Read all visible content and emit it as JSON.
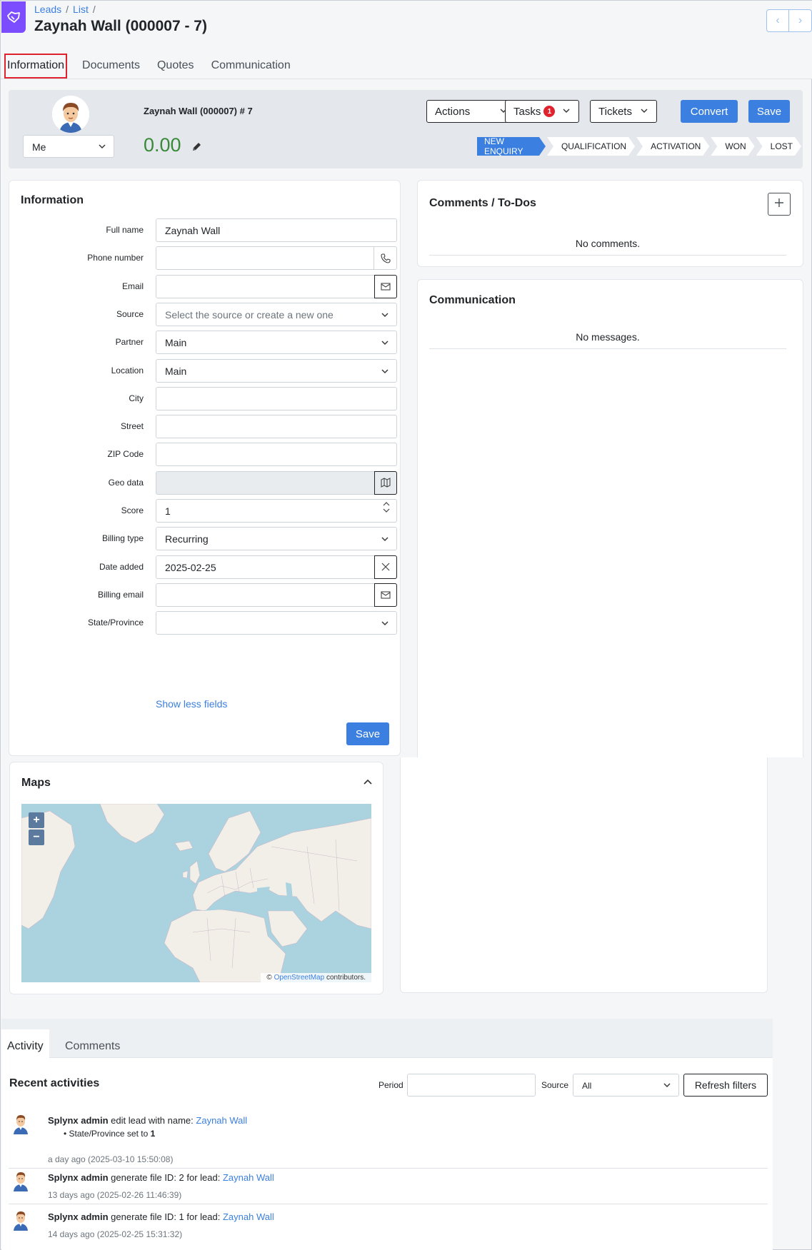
{
  "breadcrumb": [
    "Leads",
    "List"
  ],
  "page_title": "Zaynah Wall (000007 - 7)",
  "tabs": [
    "Information",
    "Documents",
    "Quotes",
    "Communication"
  ],
  "header": {
    "assignee": "Me",
    "lead_name": "Zaynah Wall (000007) # 7",
    "amount": "0.00",
    "buttons": {
      "actions": "Actions",
      "tasks": "Tasks",
      "tasks_badge": "1",
      "tickets": "Tickets",
      "convert": "Convert",
      "save": "Save"
    },
    "pipeline": [
      "NEW ENQUIRY",
      "QUALIFICATION",
      "ACTIVATION",
      "WON",
      "LOST"
    ],
    "active_stage": "NEW ENQUIRY"
  },
  "info": {
    "title": "Information",
    "fields": [
      {
        "label": "Full name",
        "value": "Zaynah Wall",
        "placeholder": ""
      },
      {
        "label": "Phone number",
        "value": "",
        "placeholder": ""
      },
      {
        "label": "Email",
        "value": "",
        "placeholder": ""
      },
      {
        "label": "Source",
        "value": "",
        "placeholder": "Select the source or create a new one"
      },
      {
        "label": "Partner",
        "value": "Main",
        "placeholder": ""
      },
      {
        "label": "Location",
        "value": "Main",
        "placeholder": ""
      },
      {
        "label": "City",
        "value": "",
        "placeholder": ""
      },
      {
        "label": "Street",
        "value": "",
        "placeholder": ""
      },
      {
        "label": "ZIP Code",
        "value": "",
        "placeholder": ""
      },
      {
        "label": "Geo data",
        "value": "",
        "placeholder": ""
      },
      {
        "label": "Score",
        "value": "1",
        "placeholder": ""
      },
      {
        "label": "Billing type",
        "value": "Recurring",
        "placeholder": ""
      },
      {
        "label": "Date added",
        "value": "2025-02-25",
        "placeholder": ""
      },
      {
        "label": "Billing email",
        "value": "",
        "placeholder": ""
      },
      {
        "label": "State/Province",
        "value": "",
        "placeholder": ""
      }
    ],
    "show_less": "Show less fields",
    "save": "Save"
  },
  "comments": {
    "title": "Comments / To-Dos",
    "empty": "No comments."
  },
  "communication": {
    "title": "Communication",
    "empty": "No messages."
  },
  "maps": {
    "title": "Maps",
    "zoom_in": "+",
    "zoom_out": "−",
    "attribution_prefix": "©",
    "attribution_link": "OpenStreetMap",
    "attribution_suffix": "contributors."
  },
  "bottom_tabs": [
    "Activity",
    "Comments"
  ],
  "activities": {
    "title": "Recent activities",
    "period_label": "Period",
    "source_label": "Source",
    "source_value": "All",
    "refresh": "Refresh filters",
    "items": [
      {
        "user": "Splynx admin",
        "text": "edit lead with name:",
        "link": "Zaynah Wall",
        "detail_label": "State/Province set to",
        "detail_value": "1",
        "time": "a day ago (2025-03-10 15:50:08)"
      },
      {
        "user": "Splynx admin",
        "text": "generate file ID: 2 for lead:",
        "link": "Zaynah Wall",
        "time": "13 days ago (2025-02-26 11:46:39)"
      },
      {
        "user": "Splynx admin",
        "text": "generate file ID: 1 for lead:",
        "link": "Zaynah Wall",
        "time": "14 days ago (2025-02-25 15:31:32)"
      }
    ]
  },
  "colors": {
    "primary": "#3b7fe0",
    "accent": "#7c4dff",
    "amount": "#3a8a3a",
    "badge": "#e0212e"
  }
}
